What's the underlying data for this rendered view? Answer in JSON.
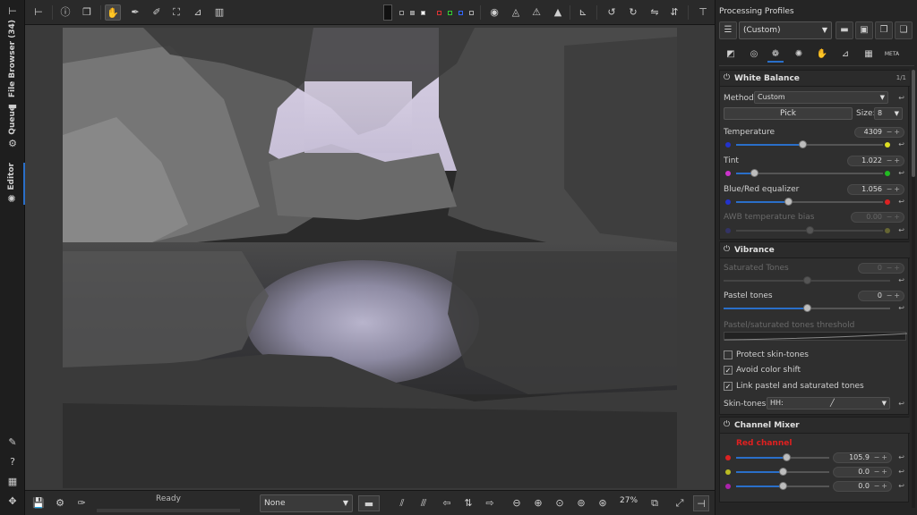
{
  "left_tabs": {
    "file_browser": "File Browser (34)",
    "queue": "Queue",
    "editor": "Editor"
  },
  "right_panel": {
    "title": "Processing Profiles",
    "profile_value": "(Custom)"
  },
  "white_balance": {
    "title": "White Balance",
    "method_label": "Method:",
    "method_value": "Custom",
    "pick_label": "Pick",
    "size_label": "Size:",
    "size_value": "8",
    "temperature_label": "Temperature",
    "temperature_value": "4309",
    "temperature_fraction": 0.45,
    "tint_label": "Tint",
    "tint_value": "1.022",
    "tint_fraction": 0.1,
    "bluered_label": "Blue/Red equalizer",
    "bluered_value": "1.056",
    "bluered_fraction": 0.35,
    "awb_label": "AWB temperature bias",
    "awb_value": "0.00",
    "awb_fraction": 0.5
  },
  "vibrance": {
    "title": "Vibrance",
    "saturated_label": "Saturated Tones",
    "saturated_value": "0",
    "saturated_fraction": 0.5,
    "pastel_label": "Pastel tones",
    "pastel_value": "0",
    "pastel_fraction": 0.5,
    "threshold_label": "Pastel/saturated tones threshold",
    "protect_label": "Protect skin-tones",
    "protect_checked": false,
    "avoid_label": "Avoid color shift",
    "avoid_checked": true,
    "link_label": "Link pastel and saturated tones",
    "link_checked": true,
    "skintones_label": "Skin-tones:",
    "skintones_value": "HH:"
  },
  "channel_mixer": {
    "title": "Channel Mixer",
    "red_channel_label": "Red channel",
    "r_value": "105.9",
    "r_fraction": 0.55,
    "g_value": "0.0",
    "g_fraction": 0.5,
    "b_value": "0.0",
    "b_fraction": 0.5
  },
  "bottom": {
    "status": "Ready",
    "profile_select": "None",
    "zoom": "27%"
  },
  "colors": {
    "accent": "#2a6fc9",
    "red_channel": "#e02020"
  }
}
